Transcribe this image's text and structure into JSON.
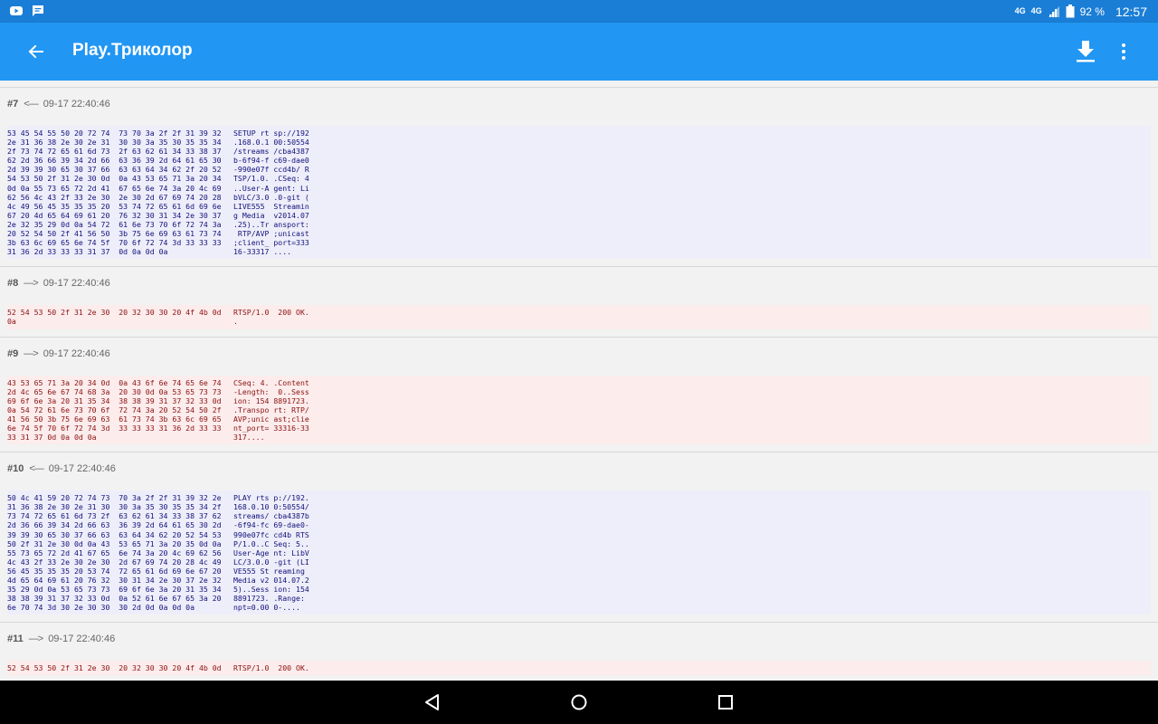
{
  "status_bar": {
    "left_icons": [
      "youtube-icon",
      "message-icon"
    ],
    "net1": "4G",
    "net2": "4G",
    "battery_percent": "92 %",
    "time": "12:57"
  },
  "app_bar": {
    "title": "Play.Триколор",
    "icons": [
      "back-arrow-icon",
      "download-icon",
      "more-vert-icon"
    ]
  },
  "entries": [
    {
      "num": "#7",
      "dir": "<—",
      "time": "09-17 22:40:46",
      "kind": "sent",
      "hex": [
        "53 45 54 55 50 20 72 74  73 70 3a 2f 2f 31 39 32",
        "2e 31 36 38 2e 30 2e 31  30 30 3a 35 30 35 35 34",
        "2f 73 74 72 65 61 6d 73  2f 63 62 61 34 33 38 37",
        "62 2d 36 66 39 34 2d 66  63 36 39 2d 64 61 65 30",
        "2d 39 39 30 65 30 37 66  63 63 64 34 62 2f 20 52",
        "54 53 50 2f 31 2e 30 0d  0a 43 53 65 71 3a 20 34",
        "0d 0a 55 73 65 72 2d 41  67 65 6e 74 3a 20 4c 69",
        "62 56 4c 43 2f 33 2e 30  2e 30 2d 67 69 74 20 28",
        "4c 49 56 45 35 35 35 20  53 74 72 65 61 6d 69 6e",
        "67 20 4d 65 64 69 61 20  76 32 30 31 34 2e 30 37",
        "2e 32 35 29 0d 0a 54 72  61 6e 73 70 6f 72 74 3a",
        "20 52 54 50 2f 41 56 50  3b 75 6e 69 63 61 73 74",
        "3b 63 6c 69 65 6e 74 5f  70 6f 72 74 3d 33 33 33",
        "31 36 2d 33 33 33 31 37  0d 0a 0d 0a"
      ],
      "ascii": [
        "SETUP rt sp://192",
        ".168.0.1 00:50554",
        "/streams /cba4387",
        "b-6f94-f c69-dae0",
        "-990e07f ccd4b/ R",
        "TSP/1.0. .CSeq: 4",
        "..User-A gent: Li",
        "bVLC/3.0 .0-git (",
        "LIVE555  Streamin",
        "g Media  v2014.07",
        ".25)..Tr ansport:",
        " RTP/AVP ;unicast",
        ";client_ port=333",
        "16-33317 ...."
      ]
    },
    {
      "num": "#8",
      "dir": "—>",
      "time": "09-17 22:40:46",
      "kind": "recv",
      "hex": [
        "52 54 53 50 2f 31 2e 30  20 32 30 30 20 4f 4b 0d",
        "0a"
      ],
      "ascii": [
        "RTSP/1.0  200 OK.",
        "."
      ]
    },
    {
      "num": "#9",
      "dir": "—>",
      "time": "09-17 22:40:46",
      "kind": "recv",
      "hex": [
        "43 53 65 71 3a 20 34 0d  0a 43 6f 6e 74 65 6e 74",
        "2d 4c 65 6e 67 74 68 3a  20 30 0d 0a 53 65 73 73",
        "69 6f 6e 3a 20 31 35 34  38 38 39 31 37 32 33 0d",
        "0a 54 72 61 6e 73 70 6f  72 74 3a 20 52 54 50 2f",
        "41 56 50 3b 75 6e 69 63  61 73 74 3b 63 6c 69 65",
        "6e 74 5f 70 6f 72 74 3d  33 33 33 31 36 2d 33 33",
        "33 31 37 0d 0a 0d 0a"
      ],
      "ascii": [
        "CSeq: 4. .Content",
        "-Length:  0..Sess",
        "ion: 154 8891723.",
        ".Transpo rt: RTP/",
        "AVP;unic ast;clie",
        "nt_port= 33316-33",
        "317...."
      ]
    },
    {
      "num": "#10",
      "dir": "<—",
      "time": "09-17 22:40:46",
      "kind": "sent",
      "hex": [
        "50 4c 41 59 20 72 74 73  70 3a 2f 2f 31 39 32 2e",
        "31 36 38 2e 30 2e 31 30  30 3a 35 30 35 35 34 2f",
        "73 74 72 65 61 6d 73 2f  63 62 61 34 33 38 37 62",
        "2d 36 66 39 34 2d 66 63  36 39 2d 64 61 65 30 2d",
        "39 39 30 65 30 37 66 63  63 64 34 62 20 52 54 53",
        "50 2f 31 2e 30 0d 0a 43  53 65 71 3a 20 35 0d 0a",
        "55 73 65 72 2d 41 67 65  6e 74 3a 20 4c 69 62 56",
        "4c 43 2f 33 2e 30 2e 30  2d 67 69 74 20 28 4c 49",
        "56 45 35 35 35 20 53 74  72 65 61 6d 69 6e 67 20",
        "4d 65 64 69 61 20 76 32  30 31 34 2e 30 37 2e 32",
        "35 29 0d 0a 53 65 73 73  69 6f 6e 3a 20 31 35 34",
        "38 38 39 31 37 32 33 0d  0a 52 61 6e 67 65 3a 20",
        "6e 70 74 3d 30 2e 30 30  30 2d 0d 0a 0d 0a"
      ],
      "ascii": [
        "PLAY rts p://192.",
        "168.0.10 0:50554/",
        "streams/ cba4387b",
        "-6f94-fc 69-dae0-",
        "990e07fc cd4b RTS",
        "P/1.0..C Seq: 5..",
        "User-Age nt: LibV",
        "LC/3.0.0 -git (LI",
        "VE555 St reaming ",
        "Media v2 014.07.2",
        "5)..Sess ion: 154",
        "8891723. .Range: ",
        "npt=0.00 0-...."
      ]
    },
    {
      "num": "#11",
      "dir": "—>",
      "time": "09-17 22:40:46",
      "kind": "recv",
      "hex": [
        "52 54 53 50 2f 31 2e 30  20 32 30 30 20 4f 4b 0d"
      ],
      "ascii": [
        "RTSP/1.0  200 OK."
      ]
    }
  ],
  "nav_bar": {
    "icons": [
      "back-triangle-icon",
      "home-circle-icon",
      "recents-square-icon"
    ]
  }
}
